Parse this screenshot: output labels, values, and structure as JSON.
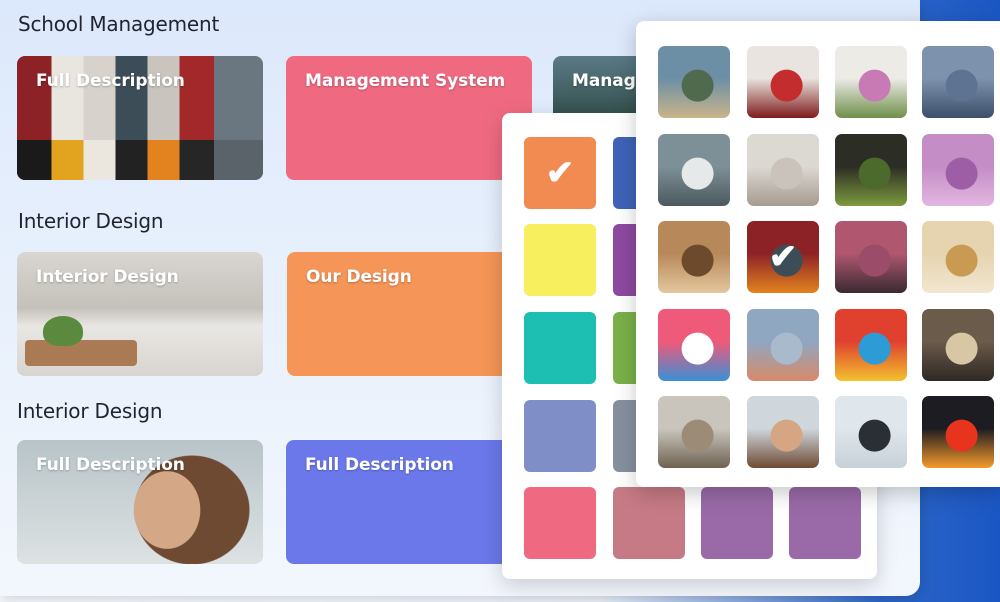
{
  "sections": [
    {
      "title": "School Management",
      "tiles": [
        {
          "label": "Full Description",
          "style": "img-lockers"
        },
        {
          "label": "Management System",
          "style": "solid-pink"
        },
        {
          "label": "Manage",
          "style": "img-mountain"
        }
      ]
    },
    {
      "title": "Interior Design",
      "tiles": [
        {
          "label": "Interior Design",
          "style": "img-kitchen"
        },
        {
          "label": "Our Design",
          "style": "solid-orange"
        }
      ]
    },
    {
      "title": "Interior Design",
      "tiles": [
        {
          "label": "Full Description",
          "style": "img-woman"
        },
        {
          "label": "Full Description",
          "style": "solid-blue"
        }
      ]
    }
  ],
  "color_panel": {
    "selected_index": 0,
    "check_glyph": "✔",
    "swatches": [
      "#f28b52",
      "#3f63b8",
      "#f7ef5e",
      "#8e4aa1",
      "#1dbfb2",
      "#7ab14a",
      "#7f8ec7",
      "#8890a0",
      "#ef6a80",
      "#c67a85",
      "#9a6aa8",
      "#9a6aa8"
    ]
  },
  "image_panel": {
    "selected_index": 9,
    "check_glyph": "✔",
    "thumbnails": [
      {
        "name": "mountain-lake-thumbnail",
        "colors": [
          "#6d8fa6",
          "#4f6a4c",
          "#c9b48a"
        ]
      },
      {
        "name": "red-flower-thumbnail",
        "colors": [
          "#e9e4df",
          "#c42d2d",
          "#7e1b1b"
        ]
      },
      {
        "name": "flower-vase-thumbnail",
        "colors": [
          "#ecebe6",
          "#c77ab3",
          "#6f8f4a"
        ]
      },
      {
        "name": "water-surface-thumbnail",
        "colors": [
          "#7d92ad",
          "#5d7391",
          "#3c4f6b"
        ]
      },
      {
        "name": "white-truck-thumbnail",
        "colors": [
          "#7d8f97",
          "#e6e9ea",
          "#4c5a5e"
        ]
      },
      {
        "name": "kitchen-interior-thumbnail",
        "colors": [
          "#dcd8d2",
          "#c9c3bb",
          "#a59b90"
        ]
      },
      {
        "name": "green-plant-thumbnail",
        "colors": [
          "#2c2d25",
          "#4c6a2c",
          "#7e9a3e"
        ]
      },
      {
        "name": "purple-fabric-thumbnail",
        "colors": [
          "#c48dc6",
          "#9d5ea6",
          "#e2b6df"
        ]
      },
      {
        "name": "bread-loaf-thumbnail",
        "colors": [
          "#b7885a",
          "#6e4a2c",
          "#e4c79e"
        ]
      },
      {
        "name": "lockers-thumbnail",
        "colors": [
          "#8c2226",
          "#3d4d58",
          "#e3831f"
        ]
      },
      {
        "name": "birds-sky-thumbnail",
        "colors": [
          "#b0576f",
          "#9a4c68",
          "#3a2a33"
        ]
      },
      {
        "name": "globe-thumbnail",
        "colors": [
          "#e6d4b0",
          "#c99a52",
          "#f2e6cf"
        ]
      },
      {
        "name": "cartoon-woman-thumbnail",
        "colors": [
          "#f05a7a",
          "#ffffff",
          "#3a8fd6"
        ]
      },
      {
        "name": "hot-air-balloon-thumbnail",
        "colors": [
          "#8fa7c0",
          "#a9bacd",
          "#d88a6a"
        ]
      },
      {
        "name": "colorful-abstract-thumbnail",
        "colors": [
          "#e0412f",
          "#2d9bd6",
          "#f2c12e"
        ]
      },
      {
        "name": "vintage-car-thumbnail",
        "colors": [
          "#6b5b4a",
          "#d8c7a4",
          "#2e2824"
        ]
      },
      {
        "name": "colosseum-thumbnail",
        "colors": [
          "#c9c5bd",
          "#9c8b76",
          "#6e6251"
        ]
      },
      {
        "name": "woman-portrait-thumbnail",
        "colors": [
          "#cfd7dd",
          "#d5a584",
          "#6e4a33"
        ]
      },
      {
        "name": "earbuds-thumbnail",
        "colors": [
          "#dfe6ec",
          "#2a2f36",
          "#c8d1d8"
        ]
      },
      {
        "name": "red-car-thumbnail",
        "colors": [
          "#1c1c22",
          "#e8341f",
          "#f59a2b"
        ]
      }
    ]
  }
}
